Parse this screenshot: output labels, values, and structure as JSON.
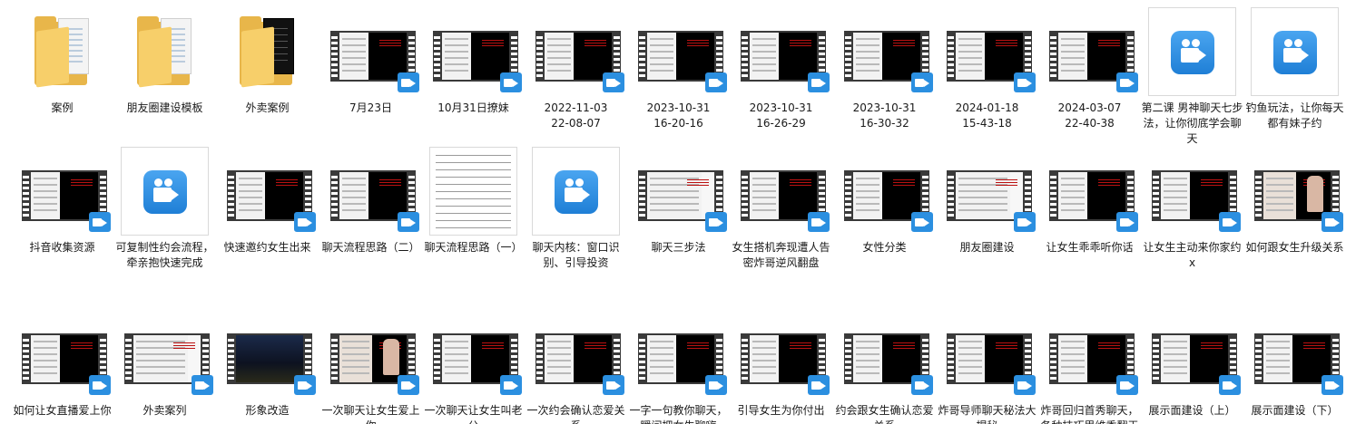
{
  "items": [
    {
      "type": "folder",
      "label": "案例"
    },
    {
      "type": "folder",
      "label": "朋友圈建设模板"
    },
    {
      "type": "folder-dark",
      "label": "外卖案例"
    },
    {
      "type": "video",
      "label": "7月23日"
    },
    {
      "type": "video",
      "label": "10月31日撩妹"
    },
    {
      "type": "video",
      "label": "2022-11-03\n22-08-07"
    },
    {
      "type": "video",
      "label": "2023-10-31\n16-20-16"
    },
    {
      "type": "video",
      "label": "2023-10-31\n16-26-29"
    },
    {
      "type": "video",
      "label": "2023-10-31\n16-30-32"
    },
    {
      "type": "video",
      "label": "2024-01-18\n15-43-18"
    },
    {
      "type": "video",
      "label": "2024-03-07\n22-40-38"
    },
    {
      "type": "app",
      "label": "第二课 男神聊天七步法，让你彻底学会聊天"
    },
    {
      "type": "app",
      "label": "钓鱼玩法，让你每天都有妹子约"
    },
    {
      "type": "video",
      "label": "抖音收集资源"
    },
    {
      "type": "app",
      "label": "可复制性约会流程，牵亲抱快速完成"
    },
    {
      "type": "video",
      "label": "快速邀约女生出来"
    },
    {
      "type": "video",
      "label": "聊天流程思路（二）"
    },
    {
      "type": "doc",
      "label": "聊天流程思路（一）"
    },
    {
      "type": "app",
      "label": "聊天内核：窗口识别、引导投资"
    },
    {
      "type": "video-light",
      "label": "聊天三步法"
    },
    {
      "type": "video",
      "label": "女生搭机奔现遭人告密炸哥逆风翻盘"
    },
    {
      "type": "video",
      "label": "女性分类"
    },
    {
      "type": "video-light",
      "label": "朋友圈建设"
    },
    {
      "type": "video",
      "label": "让女生乖乖听你话"
    },
    {
      "type": "video",
      "label": "让女生主动来你家约x"
    },
    {
      "type": "video-pic",
      "label": "如何跟女生升级关系"
    },
    {
      "type": "video",
      "label": "如何让女直播爱上你"
    },
    {
      "type": "video-light",
      "label": "外卖案列"
    },
    {
      "type": "video-night",
      "label": "形象改造"
    },
    {
      "type": "video-pic",
      "label": "一次聊天让女生爱上你"
    },
    {
      "type": "video",
      "label": "一次聊天让女生叫老公"
    },
    {
      "type": "video",
      "label": "一次约会确认恋爱关系"
    },
    {
      "type": "video",
      "label": "一字一句教你聊天，瞬间把女生聊嗨"
    },
    {
      "type": "video",
      "label": "引导女生为你付出"
    },
    {
      "type": "video",
      "label": "约会跟女生确认恋爱关系"
    },
    {
      "type": "video",
      "label": "炸哥导师聊天秘法大揭秘"
    },
    {
      "type": "video",
      "label": "炸哥回归首秀聊天，各种技巧思维秀翻天"
    },
    {
      "type": "video",
      "label": "展示面建设（上）"
    },
    {
      "type": "video",
      "label": "展示面建设（下）"
    }
  ]
}
